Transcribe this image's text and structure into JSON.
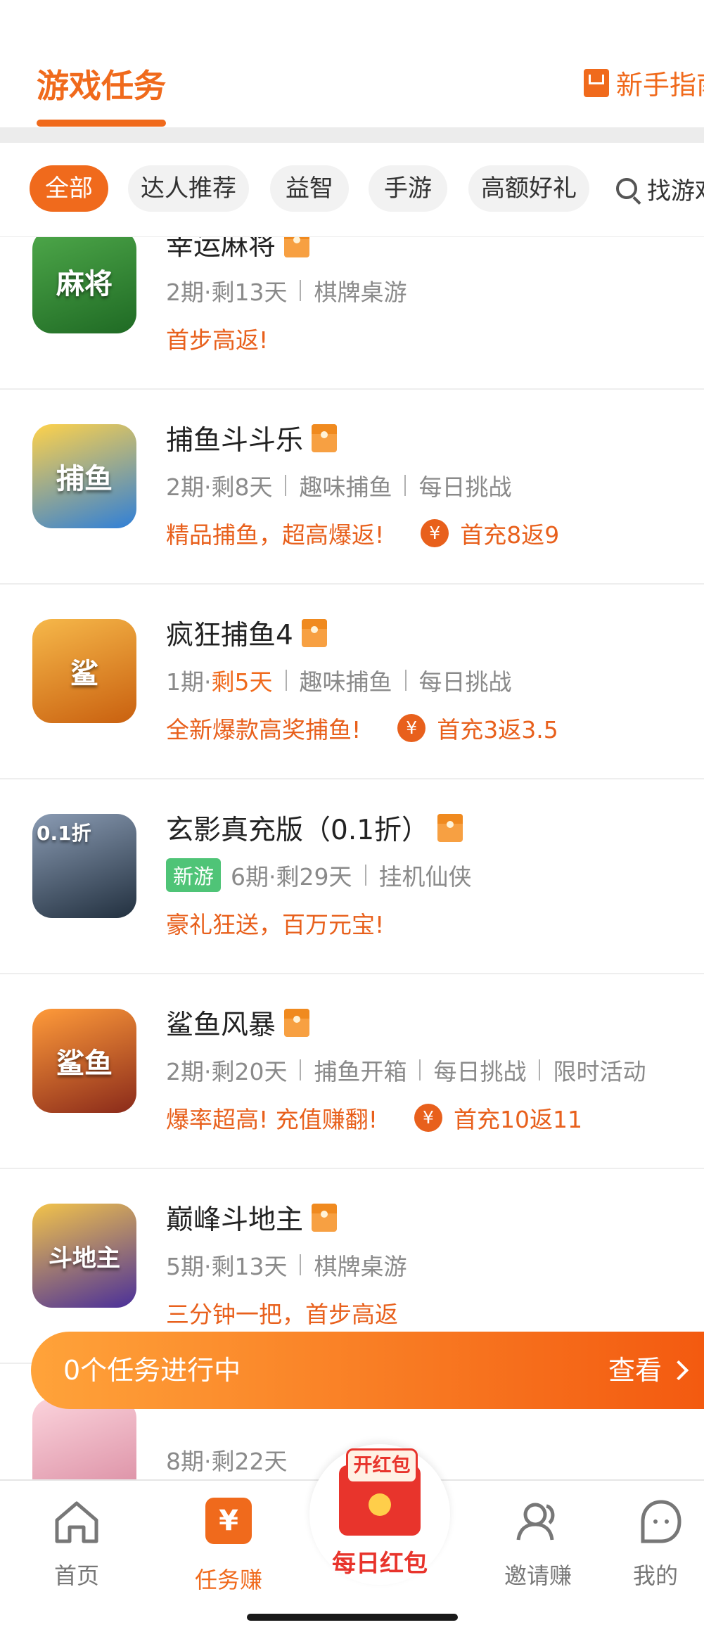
{
  "header": {
    "title": "游戏任务",
    "guide_label": "新手指南"
  },
  "tabs": {
    "items": [
      "全部",
      "达人推荐",
      "益智",
      "手游",
      "高额好礼"
    ],
    "search_label": "找游戏"
  },
  "games": [
    {
      "name": "幸运麻将",
      "icon_text": "麻将",
      "icon_bg": "#3b8a3a",
      "meta": [
        {
          "text": "2期·剩13天"
        },
        {
          "text": "棋牌桌游"
        }
      ],
      "promo": "首步高返!",
      "offer": ""
    },
    {
      "name": "捕鱼斗斗乐",
      "icon_text": "捕鱼",
      "icon_bg": "#2f7fd8",
      "meta": [
        {
          "text": "2期·剩8天"
        },
        {
          "text": "趣味捕鱼"
        },
        {
          "text": "每日挑战"
        }
      ],
      "promo": "精品捕鱼，超高爆返!",
      "offer": "首充8返9"
    },
    {
      "name": "疯狂捕鱼4",
      "icon_text": "鲨",
      "icon_bg": "#e0891c",
      "meta_prefix": "1期·",
      "meta_hl": "剩5天",
      "meta": [
        {
          "text": "趣味捕鱼"
        },
        {
          "text": "每日挑战"
        }
      ],
      "promo": "全新爆款高奖捕鱼!",
      "offer": "首充3返3.5"
    },
    {
      "name": "玄影真充版（0.1折）",
      "icon_text": "0.1折",
      "icon_bg": "#3c4a5e",
      "badge": "新游",
      "meta": [
        {
          "text": "6期·剩29天"
        },
        {
          "text": "挂机仙侠"
        }
      ],
      "promo": "豪礼狂送，百万元宝!",
      "offer": ""
    },
    {
      "name": "鲨鱼风暴",
      "icon_text": "鲨鱼",
      "icon_bg": "#d84a2a",
      "meta": [
        {
          "text": "2期·剩20天"
        },
        {
          "text": "捕鱼开箱"
        },
        {
          "text": "每日挑战"
        },
        {
          "text": "限时活动"
        }
      ],
      "promo": "爆率超高! 充值赚翻!",
      "offer": "首充10返11"
    },
    {
      "name": "巅峰斗地主",
      "icon_text": "斗地主",
      "icon_bg": "#5a3fa8",
      "meta": [
        {
          "text": "5期·剩13天"
        },
        {
          "text": "棋牌桌游"
        }
      ],
      "promo": "三分钟一把，首步高返",
      "offer": ""
    },
    {
      "name": "",
      "icon_text": "",
      "icon_bg": "#f2b7c4",
      "meta": [
        {
          "text": "8期·剩22天"
        }
      ],
      "promo": "",
      "offer": ""
    }
  ],
  "floating_bar": {
    "label": "0个任务进行中",
    "view_label": "查看"
  },
  "tabbar": {
    "home": "首页",
    "tasks": "任务赚",
    "task_icon": "¥",
    "daily_redpacket": "每日红包",
    "redpacket_tag": "开红包",
    "invite": "邀请赚",
    "me": "我的"
  },
  "colors": {
    "accent": "#f06a1c",
    "green_badge": "#4fc477",
    "red": "#e8342c"
  }
}
